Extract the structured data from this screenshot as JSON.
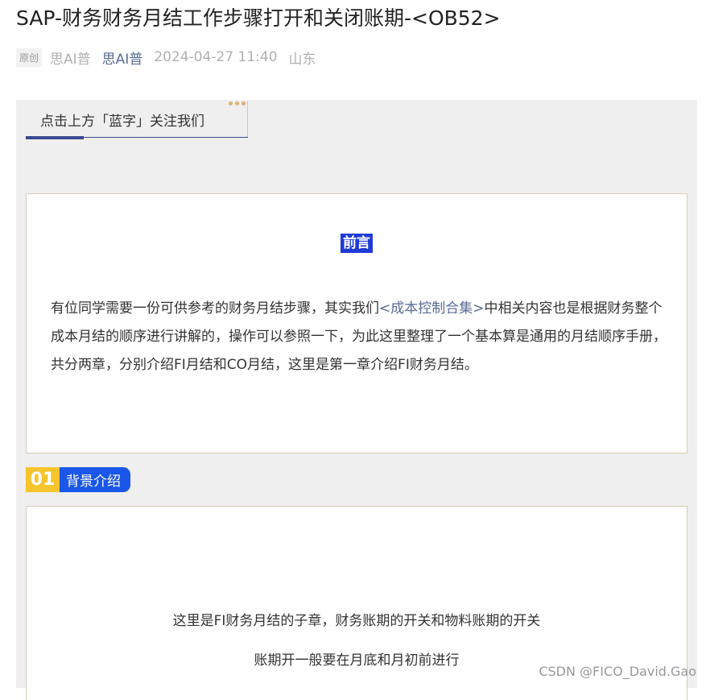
{
  "article": {
    "title": "SAP-财务财务月结工作步骤打开和关闭账期-<OB52>",
    "badge": "原创",
    "author_name": "思AI普",
    "account_name": "思AI普",
    "datetime": "2024-04-27 11:40",
    "location": "山东"
  },
  "follow": {
    "text": "点击上方「蓝字」关注我们"
  },
  "preface": {
    "heading": "前言",
    "text_before": "有位同学需要一份可供参考的财务月结步骤，其实我们",
    "link": "<成本控制合集>",
    "text_after": "中相关内容也是根据财务整个成本月结的顺序进行讲解的，操作可以参照一下，为此这里整理了一个基本算是通用的月结顺序手册，共分两章，分别介绍FI月结和CO月结，这里是第一章介绍FI财务月结。"
  },
  "section": {
    "number": "01",
    "title": "背景介绍",
    "line1": "这里是FI财务月结的子章，财务账期的开关和物料账期的开关",
    "line2": "账期开一般要在月底和月初前进行"
  },
  "watermark": "CSDN @FICO_David.Gao"
}
